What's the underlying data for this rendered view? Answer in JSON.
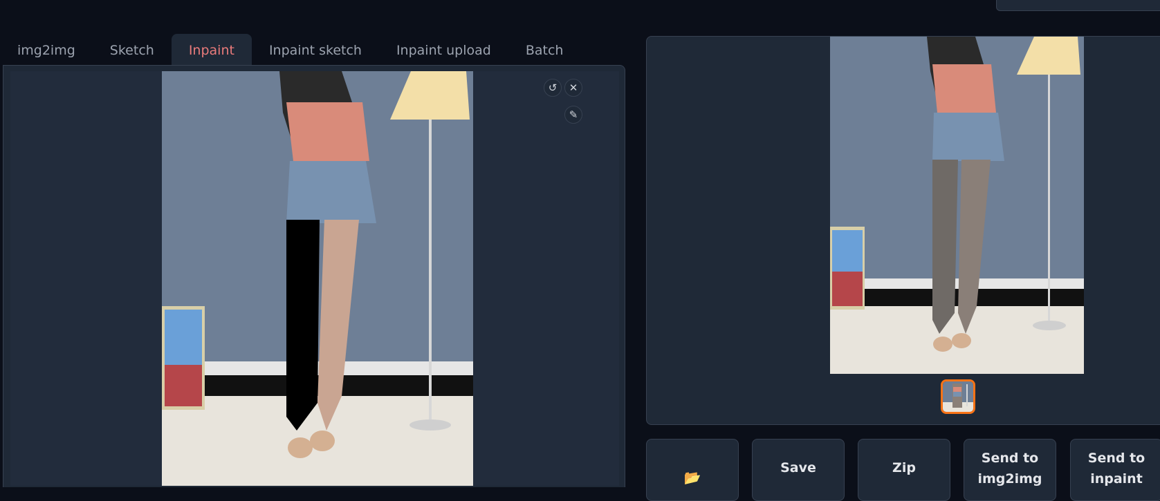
{
  "tabs": [
    {
      "label": "img2img",
      "active": false
    },
    {
      "label": "Sketch",
      "active": false
    },
    {
      "label": "Inpaint",
      "active": true
    },
    {
      "label": "Inpaint sketch",
      "active": false
    },
    {
      "label": "Inpaint upload",
      "active": false
    },
    {
      "label": "Batch",
      "active": false
    }
  ],
  "canvas": {
    "controls": [
      "undo-icon",
      "close-icon",
      "brush-icon"
    ],
    "undo_glyph": "↺",
    "close_glyph": "✕",
    "brush_glyph": "✎"
  },
  "gallery": {
    "selected_thumbnail": 1
  },
  "buttons": {
    "folder_glyph": "📂",
    "save": "Save",
    "zip": "Zip",
    "send_img2img_line1": "Send to",
    "send_img2img_line2": "img2img",
    "send_inpaint_line1": "Send to",
    "send_inpaint_line2": "inpaint"
  },
  "colors": {
    "background": "#0b0f19",
    "panel": "#1f2937",
    "active_tab": "#ea7b7b",
    "thumb_border": "#f97316"
  }
}
